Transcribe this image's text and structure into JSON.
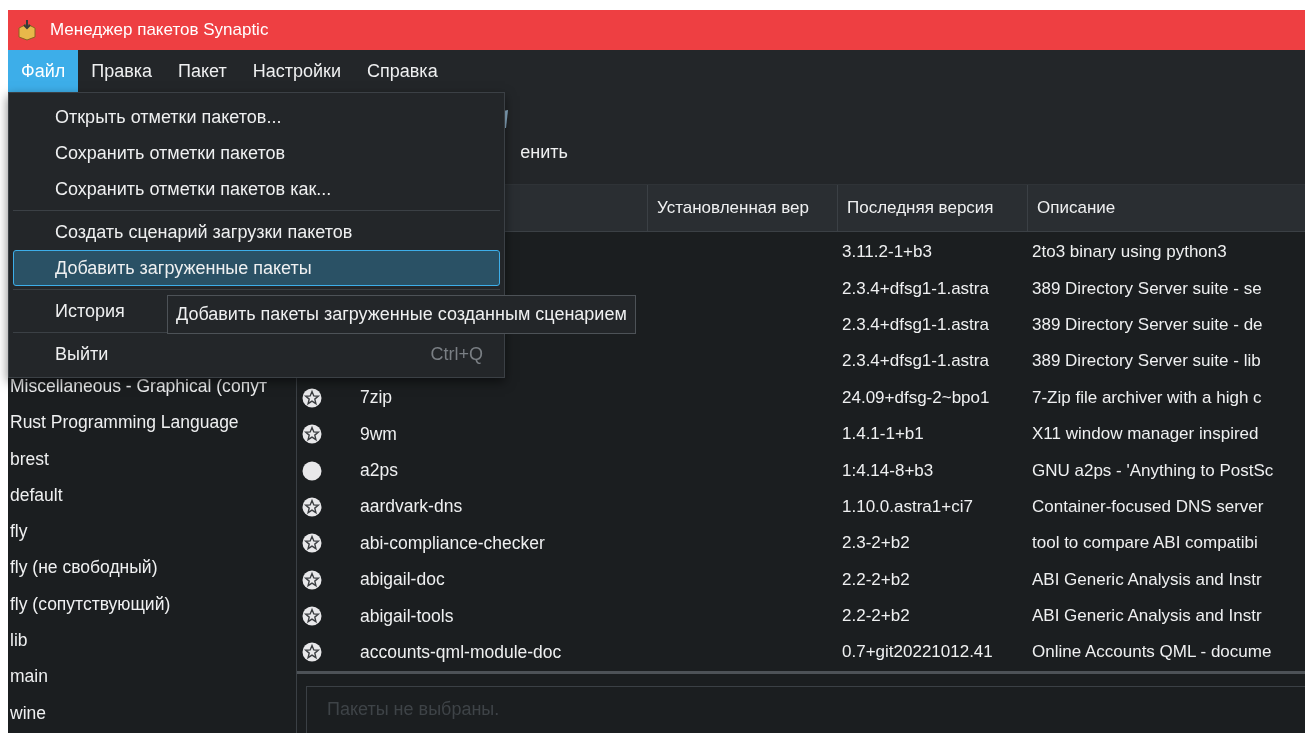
{
  "window": {
    "title": "Менеджер пакетов Synaptic"
  },
  "menubar": [
    {
      "label": "Файл",
      "selected": true
    },
    {
      "label": "Правка",
      "selected": false
    },
    {
      "label": "Пакет",
      "selected": false
    },
    {
      "label": "Настройки",
      "selected": false
    },
    {
      "label": "Справка",
      "selected": false
    }
  ],
  "file_menu": [
    {
      "kind": "item",
      "label": "Открыть отметки пакетов...",
      "selected": false
    },
    {
      "kind": "item",
      "label": "Сохранить отметки пакетов",
      "selected": false
    },
    {
      "kind": "item",
      "label": "Сохранить отметки пакетов как...",
      "selected": false
    },
    {
      "kind": "separator"
    },
    {
      "kind": "item",
      "label": "Создать сценарий загрузки пакетов",
      "selected": false
    },
    {
      "kind": "item",
      "label": "Добавить загруженные пакеты",
      "selected": true
    },
    {
      "kind": "separator"
    },
    {
      "kind": "item",
      "label": "История",
      "selected": false
    },
    {
      "kind": "separator"
    },
    {
      "kind": "item",
      "label": "Выйти",
      "selected": false,
      "shortcut": "Ctrl+Q"
    }
  ],
  "tooltip": "Добавить пакеты загруженные созданным сценарием",
  "toolbar": {
    "button_label": "енить"
  },
  "sidebar": {
    "items": [
      "Miscellaneous - Graphical (сопут",
      "Rust Programming Language",
      "brest",
      "default",
      "fly",
      "fly (не свободный)",
      "fly (сопутствующий)",
      "lib",
      "main",
      "wine"
    ]
  },
  "table": {
    "columns": [
      "Установленная вер",
      "Последняя версия",
      "Описание"
    ],
    "rows": [
      {
        "latest": "3.11.2-1+b3",
        "description": "2to3 binary using python3"
      },
      {
        "latest": "2.3.4+dfsg1-1.astra",
        "description": "389 Directory Server suite - se"
      },
      {
        "latest": "2.3.4+dfsg1-1.astra",
        "description": "389 Directory Server suite - de"
      },
      {
        "latest": "2.3.4+dfsg1-1.astra",
        "description": "389 Directory Server suite - lib"
      },
      {
        "kind": "star",
        "name": "7zip",
        "latest": "24.09+dfsg-2~bpo1",
        "description": "7-Zip file archiver with a high c"
      },
      {
        "kind": "star",
        "name": "9wm",
        "latest": "1.4.1-1+b1",
        "description": "X11 window manager inspired"
      },
      {
        "kind": "circle",
        "name": "a2ps",
        "latest": "1:4.14-8+b3",
        "description": "GNU a2ps - 'Anything to PostSc"
      },
      {
        "kind": "star",
        "name": "aardvark-dns",
        "latest": "1.10.0.astra1+ci7",
        "description": "Container-focused DNS server"
      },
      {
        "kind": "star",
        "name": "abi-compliance-checker",
        "latest": "2.3-2+b2",
        "description": "tool to compare ABI compatibi"
      },
      {
        "kind": "star",
        "name": "abigail-doc",
        "latest": "2.2-2+b2",
        "description": "ABI Generic Analysis and Instr"
      },
      {
        "kind": "star",
        "name": "abigail-tools",
        "latest": "2.2-2+b2",
        "description": "ABI Generic Analysis and Instr"
      },
      {
        "kind": "star",
        "name": "accounts-qml-module-doc",
        "latest": "0.7+git20221012.41",
        "description": "Online Accounts QML - docume"
      }
    ]
  },
  "details": {
    "text": "Пакеты не выбраны."
  }
}
